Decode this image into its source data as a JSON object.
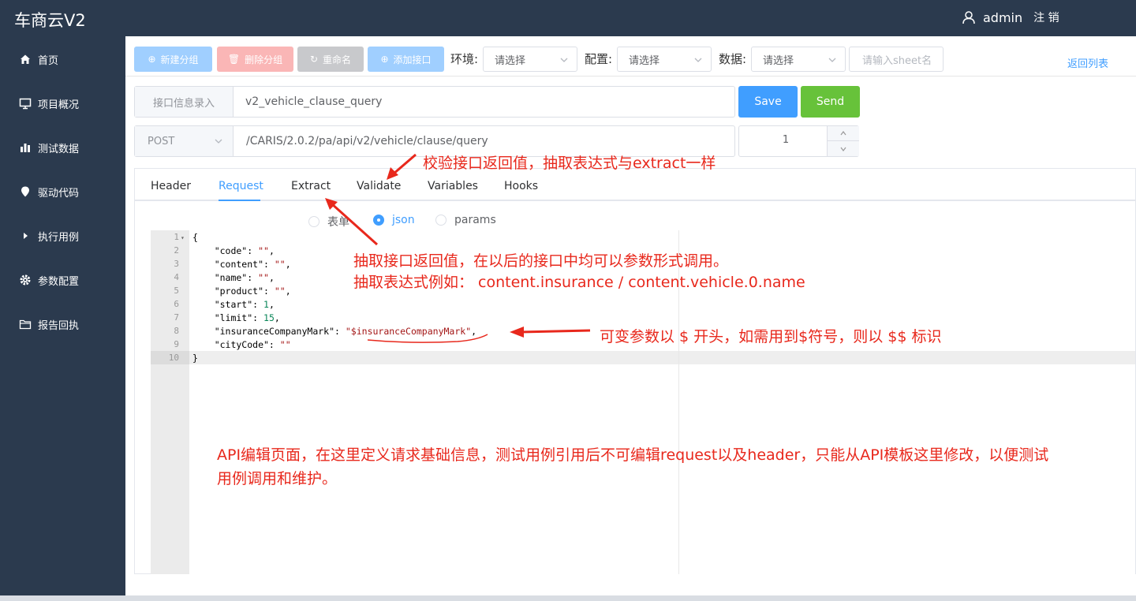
{
  "app": {
    "title": "车商云V2"
  },
  "user": {
    "name": "admin",
    "logout": "注 销"
  },
  "sidebar": {
    "items": [
      {
        "label": "首页",
        "icon": "home-icon"
      },
      {
        "label": "项目概况",
        "icon": "monitor-icon"
      },
      {
        "label": "测试数据",
        "icon": "bar-chart-icon"
      },
      {
        "label": "驱动代码",
        "icon": "location-icon"
      },
      {
        "label": "执行用例",
        "icon": "caret-right-icon"
      },
      {
        "label": "参数配置",
        "icon": "gear-icon"
      },
      {
        "label": "报告回执",
        "icon": "folder-icon"
      }
    ]
  },
  "toolbar": {
    "new_group": "新建分组",
    "delete_group": "删除分组",
    "rename": "重命名",
    "add_api": "添加接口",
    "env_label": "环境:",
    "env_placeholder": "请选择",
    "config_label": "配置:",
    "config_placeholder": "请选择",
    "data_label": "数据:",
    "data_placeholder": "请选择",
    "sheet_placeholder": "请输入sheet名",
    "back_link": "返回列表",
    "colors": {
      "primary": "#409eff",
      "primary_disabled": "#a0cfff",
      "danger_disabled": "#fab6b6",
      "info_disabled": "#c8c9cc",
      "success": "#67c23a"
    }
  },
  "form": {
    "name_prefix": "接口信息录入",
    "name_value": "v2_vehicle_clause_query",
    "method": "POST",
    "url_value": "/CARIS/2.0.2/pa/api/v2/vehicle/clause/query",
    "save": "Save",
    "send": "Send",
    "stepper_value": "1"
  },
  "tabs": [
    "Header",
    "Request",
    "Extract",
    "Validate",
    "Variables",
    "Hooks"
  ],
  "active_tab": "Request",
  "body_types": [
    {
      "label": "表单",
      "checked": false
    },
    {
      "label": "json",
      "checked": true
    },
    {
      "label": "params",
      "checked": false
    }
  ],
  "editor": {
    "line_numbers": [
      "1",
      "2",
      "3",
      "4",
      "5",
      "6",
      "7",
      "8",
      "9",
      "10"
    ],
    "lines": [
      {
        "pre": "{",
        "val": "",
        "post": "",
        "kind": ""
      },
      {
        "pre": "    \"code\": ",
        "val": "\"\"",
        "post": ",",
        "kind": "str"
      },
      {
        "pre": "    \"content\": ",
        "val": "\"\"",
        "post": ",",
        "kind": "str"
      },
      {
        "pre": "    \"name\": ",
        "val": "\"\"",
        "post": ",",
        "kind": "str"
      },
      {
        "pre": "    \"product\": ",
        "val": "\"\"",
        "post": ",",
        "kind": "str"
      },
      {
        "pre": "    \"start\": ",
        "val": "1",
        "post": ",",
        "kind": "num"
      },
      {
        "pre": "    \"limit\": ",
        "val": "15",
        "post": ",",
        "kind": "num"
      },
      {
        "pre": "    \"insuranceCompanyMark\": ",
        "val": "\"$insuranceCompanyMark\"",
        "post": ",",
        "kind": "str"
      },
      {
        "pre": "    \"cityCode\": ",
        "val": "\"\"",
        "post": "",
        "kind": "str"
      },
      {
        "pre": "}",
        "val": "",
        "post": "",
        "kind": ""
      }
    ]
  },
  "annotations": {
    "validate_note": "校验接口返回值，抽取表达式与extract一样",
    "extract_note_1": "抽取接口返回值，在以后的接口中均可以参数形式调用。",
    "extract_note_2": "抽取表达式例如： content.insurance / content.vehicle.0.name",
    "variable_note": "可变参数以 $ 开头，如需用到$符号，则以 $$ 标识",
    "page_note_1": "API编辑页面，在这里定义请求基础信息，测试用例引用后不可编辑request以及header，只能从API模板这里修改，以便测试",
    "page_note_2": "用例调用和维护。",
    "color": "#e8281c"
  }
}
